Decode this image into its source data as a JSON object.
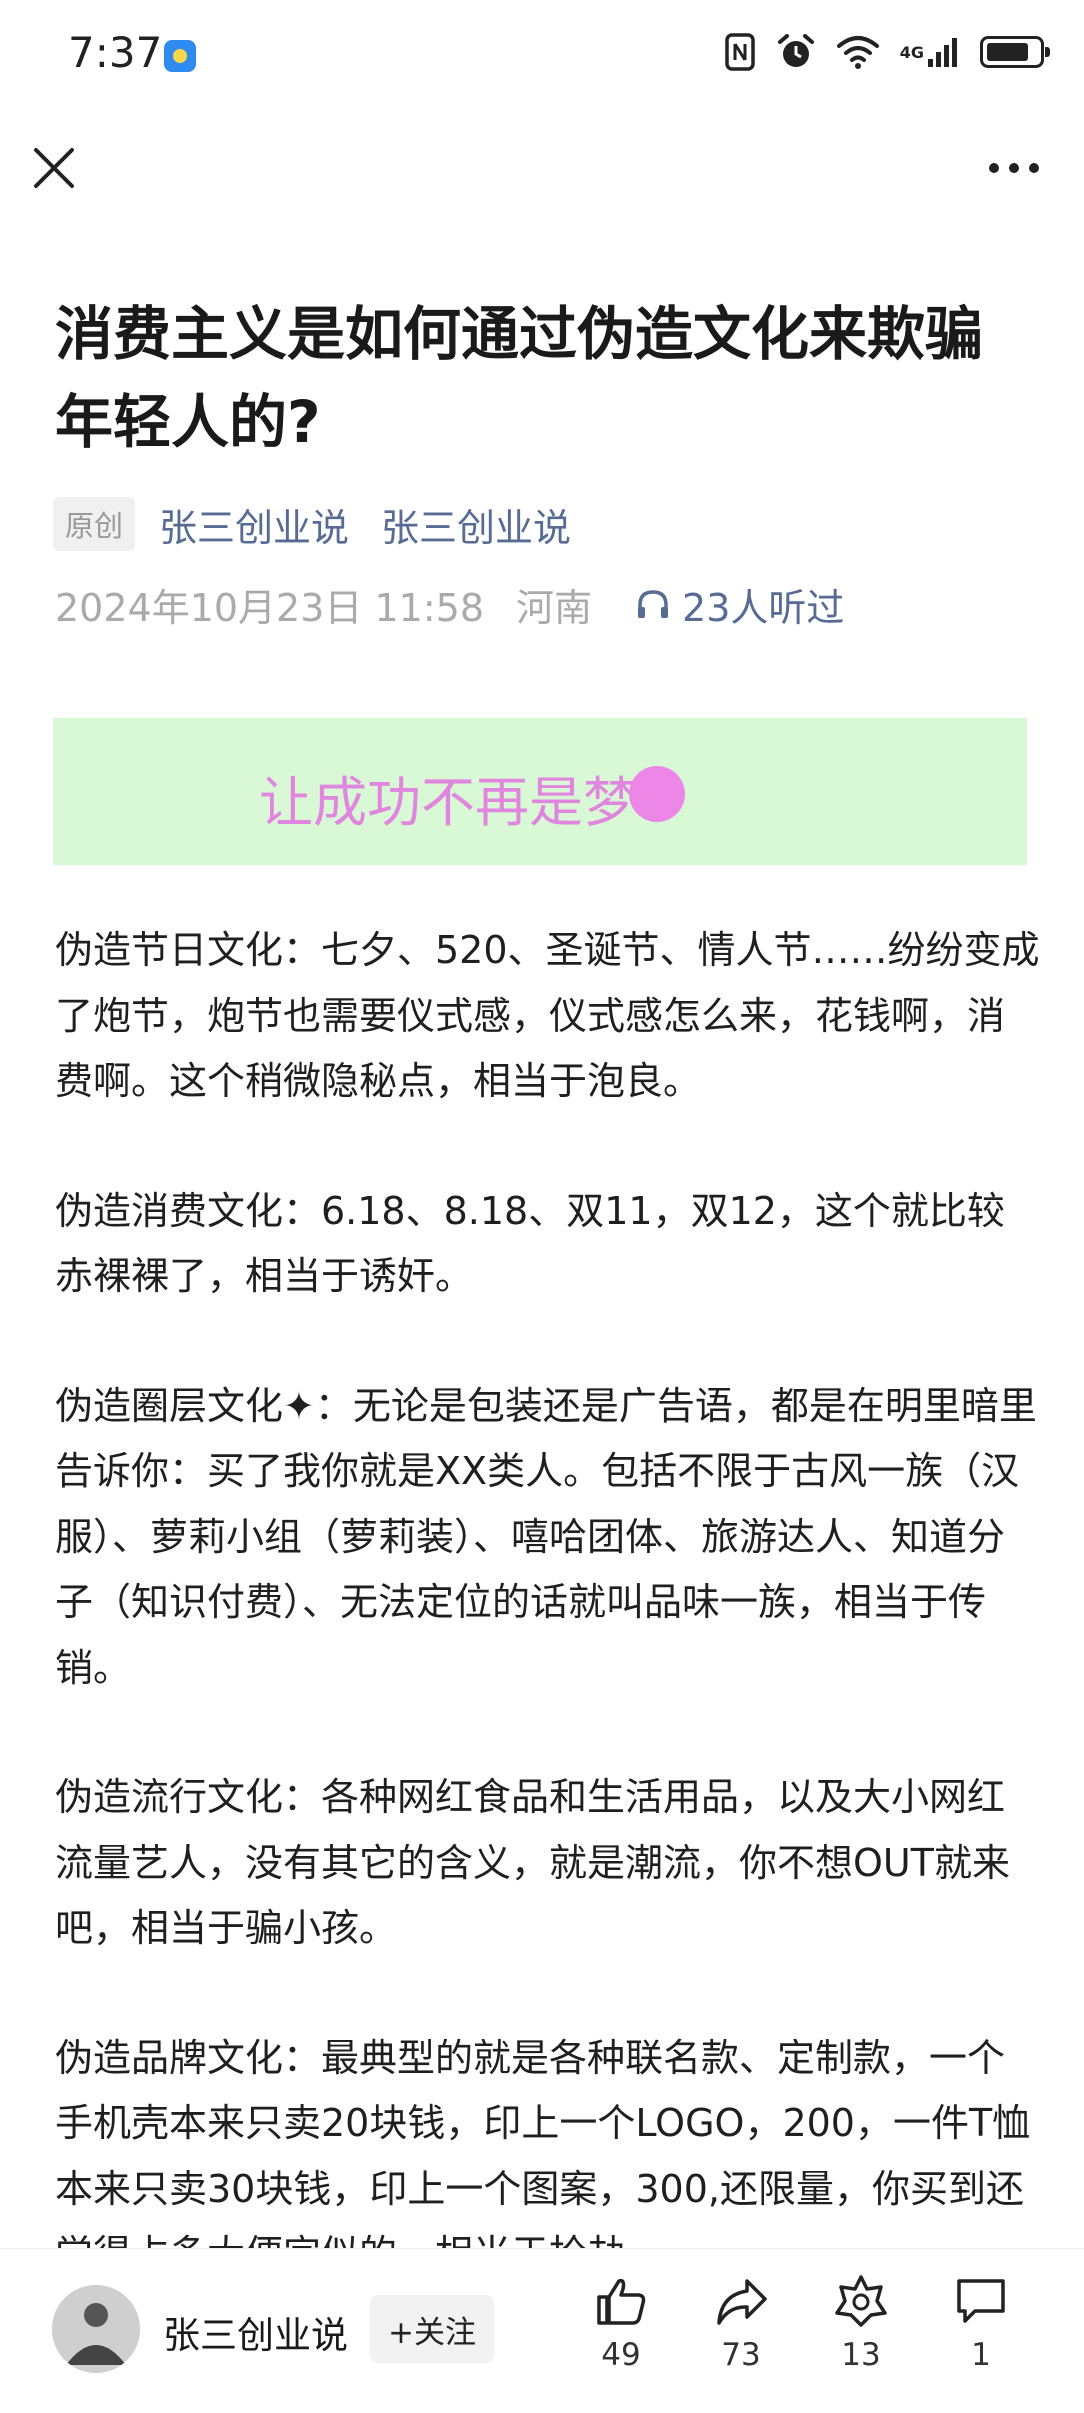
{
  "status_bar": {
    "time": "7:37",
    "network": "4G"
  },
  "article": {
    "title": "消费主义是如何通过伪造文化来欺骗年轻人的?",
    "original_badge": "原创",
    "author_primary": "张三创业说",
    "account_name": "张三创业说",
    "datetime": "2024年10月23日 11:58",
    "location": "河南",
    "listen_count": "23人听过"
  },
  "banner": {
    "text": "让成功不再是梦",
    "color": "#e186de",
    "background": "#d9f8d6"
  },
  "paragraphs": [
    "伪造节日文化：七夕、520、圣诞节、情人节……纷纷变成了炮节，炮节也需要仪式感，仪式感怎么来，花钱啊，消费啊。这个稍微隐秘点，相当于泡良。",
    "伪造消费文化：6.18、8.18、双11，双12，这个就比较赤裸裸了，相当于诱奸。",
    "伪造圈层文化✦：无论是包装还是广告语，都是在明里暗里告诉你：买了我你就是XX类人。包括不限于古风一族（汉服）、萝莉小组（萝莉装）、嘻哈团体、旅游达人、知道分子（知识付费）、无法定位的话就叫品味一族，相当于传销。",
    "伪造流行文化：各种网红食品和生活用品，以及大小网红流量艺人，没有其它的含义，就是潮流，你不想OUT就来吧，相当于骗小孩。",
    "伪造品牌文化：最典型的就是各种联名款、定制款，一个手机壳本来只卖20块钱，印上一个LOGO，200，一件T恤本来只卖30块钱，印上一个图案，300,还限量，你买到还觉得占多大便宜似的，相当于抢劫。"
  ],
  "bottom_bar": {
    "author": "张三创业说",
    "follow_label": "+关注",
    "likes": "49",
    "shares": "73",
    "favorites": "13",
    "comments": "1"
  },
  "colors": {
    "link": "#576b95",
    "meta_gray": "#aaaaaa"
  }
}
